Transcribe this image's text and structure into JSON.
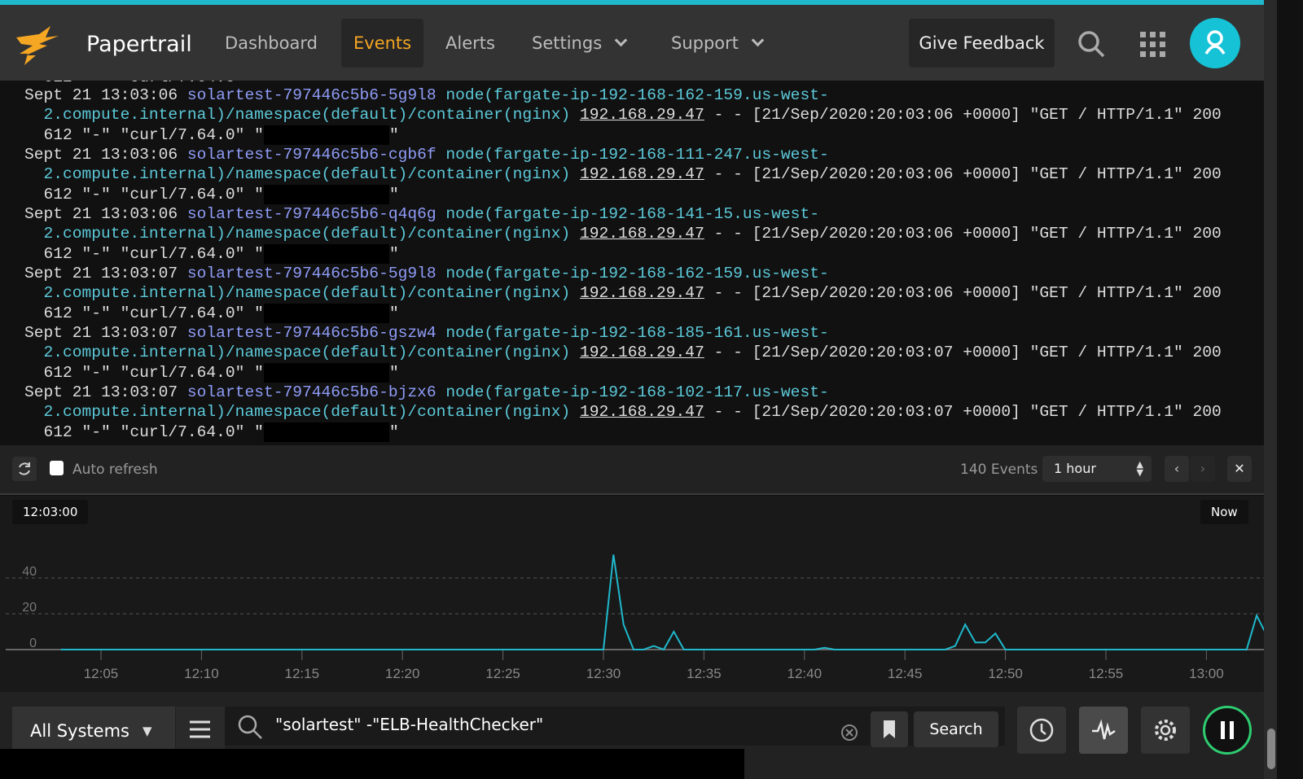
{
  "header": {
    "brand": "Papertrail",
    "nav": [
      {
        "label": "Dashboard"
      },
      {
        "label": "Events",
        "active": true
      },
      {
        "label": "Alerts"
      },
      {
        "label": "Settings",
        "dropdown": true
      },
      {
        "label": "Support",
        "dropdown": true
      }
    ],
    "feedback": "Give Feedback",
    "accent": "#1fb8cc",
    "active_color": "#f5a623"
  },
  "log": {
    "partial_line": "612 \"-\" \"curl/7.64.0\" \"",
    "events": [
      {
        "date": "Sept 21 13:03:06",
        "source": "solartest-797446c5b6-5g9l8",
        "node1": "node(fargate-ip-192-168-162-159.us-west-",
        "node2": "2.compute.internal)/namespace(default)/container(nginx)",
        "ip": "192.168.29.47",
        "msg": "- - [21/Sep/2020:20:03:06 +0000] \"GET / HTTP/1.1\" 200",
        "tail": "612 \"-\" \"curl/7.64.0\" \"",
        "end": "\""
      },
      {
        "date": "Sept 21 13:03:06",
        "source": "solartest-797446c5b6-cgb6f",
        "node1": "node(fargate-ip-192-168-111-247.us-west-",
        "node2": "2.compute.internal)/namespace(default)/container(nginx)",
        "ip": "192.168.29.47",
        "msg": "- - [21/Sep/2020:20:03:06 +0000] \"GET / HTTP/1.1\" 200",
        "tail": "612 \"-\" \"curl/7.64.0\" \"",
        "end": "\""
      },
      {
        "date": "Sept 21 13:03:06",
        "source": "solartest-797446c5b6-q4q6g",
        "node1": "node(fargate-ip-192-168-141-15.us-west-",
        "node2": "2.compute.internal)/namespace(default)/container(nginx)",
        "ip": "192.168.29.47",
        "msg": "- - [21/Sep/2020:20:03:06 +0000] \"GET / HTTP/1.1\" 200",
        "tail": "612 \"-\" \"curl/7.64.0\" \"",
        "end": "\""
      },
      {
        "date": "Sept 21 13:03:07",
        "source": "solartest-797446c5b6-5g9l8",
        "node1": "node(fargate-ip-192-168-162-159.us-west-",
        "node2": "2.compute.internal)/namespace(default)/container(nginx)",
        "ip": "192.168.29.47",
        "msg": "- - [21/Sep/2020:20:03:06 +0000] \"GET / HTTP/1.1\" 200",
        "tail": "612 \"-\" \"curl/7.64.0\" \"",
        "end": "\""
      },
      {
        "date": "Sept 21 13:03:07",
        "source": "solartest-797446c5b6-gszw4",
        "node1": "node(fargate-ip-192-168-185-161.us-west-",
        "node2": "2.compute.internal)/namespace(default)/container(nginx)",
        "ip": "192.168.29.47",
        "msg": "- - [21/Sep/2020:20:03:07 +0000] \"GET / HTTP/1.1\" 200",
        "tail": "612 \"-\" \"curl/7.64.0\" \"",
        "end": "\""
      },
      {
        "date": "Sept 21 13:03:07",
        "source": "solartest-797446c5b6-bjzx6",
        "node1": "node(fargate-ip-192-168-102-117.us-west-",
        "node2": "2.compute.internal)/namespace(default)/container(nginx)",
        "ip": "192.168.29.47",
        "msg": "- - [21/Sep/2020:20:03:07 +0000] \"GET / HTTP/1.1\" 200",
        "tail": "612 \"-\" \"curl/7.64.0\" \"",
        "end": "\""
      }
    ]
  },
  "toolbar": {
    "auto_refresh": "Auto refresh",
    "auto_refresh_checked": false,
    "count": "140 Events",
    "range": "1 hour"
  },
  "chart_data": {
    "type": "line",
    "start_label": "12:03:00",
    "end_label": "Now",
    "color": "#1fb8cc",
    "grid": true,
    "yticks": [
      "0",
      "20",
      "40"
    ],
    "ylim": [
      0,
      55
    ],
    "xticks": [
      "12:05",
      "12:10",
      "12:15",
      "12:20",
      "12:25",
      "12:30",
      "12:35",
      "12:40",
      "12:45",
      "12:50",
      "12:55",
      "13:00"
    ],
    "points": [
      [
        "12:03:00",
        0
      ],
      [
        "12:30:00",
        0
      ],
      [
        "12:30:30",
        53
      ],
      [
        "12:31:00",
        14
      ],
      [
        "12:31:30",
        0
      ],
      [
        "12:32:00",
        0
      ],
      [
        "12:32:30",
        2
      ],
      [
        "12:33:00",
        0
      ],
      [
        "12:33:30",
        10
      ],
      [
        "12:34:00",
        0
      ],
      [
        "12:40:30",
        0
      ],
      [
        "12:41:00",
        1
      ],
      [
        "12:41:30",
        0
      ],
      [
        "12:47:00",
        0
      ],
      [
        "12:47:30",
        2
      ],
      [
        "12:48:00",
        14
      ],
      [
        "12:48:30",
        4
      ],
      [
        "12:49:00",
        4
      ],
      [
        "12:49:30",
        9
      ],
      [
        "12:50:00",
        0
      ],
      [
        "13:02:00",
        0
      ],
      [
        "13:02:30",
        19
      ],
      [
        "13:03:00",
        8
      ]
    ]
  },
  "bottom": {
    "system": "All Systems",
    "query": "\"solartest\" -\"ELB-HealthChecker\"",
    "search": "Search"
  }
}
